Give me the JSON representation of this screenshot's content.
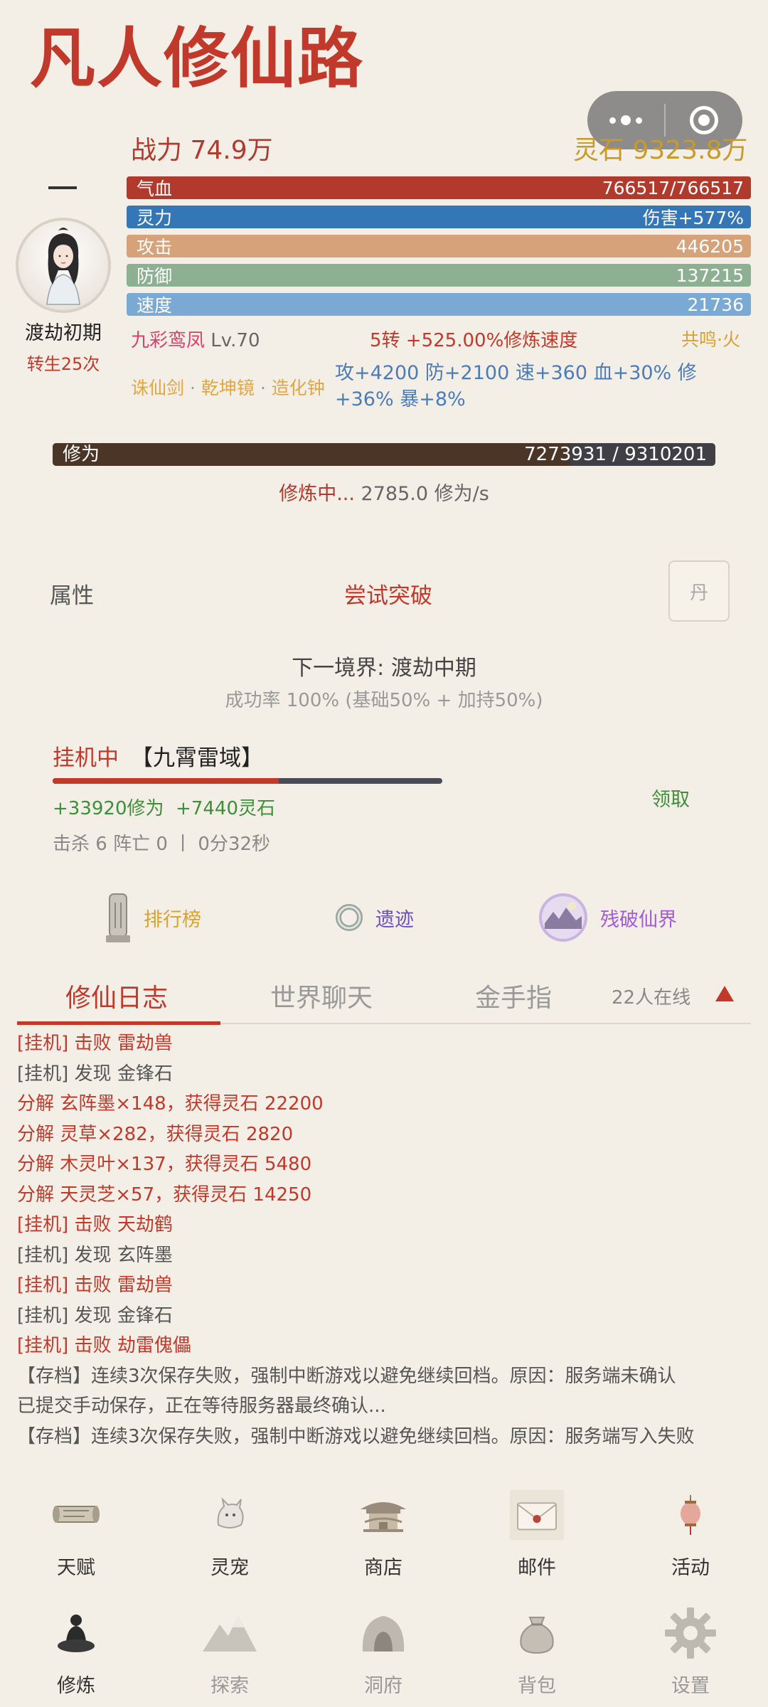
{
  "app": {
    "title": "凡人修仙路"
  },
  "header": {
    "power": "战力 74.9万",
    "stones": "灵石 9323.8万",
    "dash": "—"
  },
  "character": {
    "realm": "渡劫初期",
    "rebirth": "转生25次"
  },
  "stats": {
    "hp": {
      "label": "气血",
      "value": "766517/766517"
    },
    "mp": {
      "label": "灵力",
      "value": "伤害+577%"
    },
    "atk": {
      "label": "攻击",
      "value": "446205"
    },
    "def": {
      "label": "防御",
      "value": "137215"
    },
    "spd": {
      "label": "速度",
      "value": "21736"
    }
  },
  "pet": {
    "name": "九彩鸾凤",
    "level": "Lv.70"
  },
  "rebirth_speed": "5转 +525.00%修炼速度",
  "resonance": "共鸣·火",
  "artifacts": {
    "a1": "诛仙剑",
    "a2": "乾坤镜",
    "a3": "造化钟",
    "sep": " · "
  },
  "bonus": "攻+4200 防+2100 速+360 血+30% 修+36% 暴+8%",
  "cultivation": {
    "label": "修为",
    "value": "7273931 / 9310201",
    "progress": 0.781,
    "status": "修炼中...",
    "rate": "2785.0 修为/s"
  },
  "actions": {
    "attr": "属性",
    "breakthrough": "尝试突破",
    "dan": "丹"
  },
  "next": {
    "realm": "下一境界: 渡劫中期",
    "rate": "成功率 100% (基础50% + 加持50%)"
  },
  "afk": {
    "status": "挂机中",
    "zone": "【九霄雷域】",
    "progress": 0.58,
    "gain_exp": "+33920修为",
    "gain_stone": "+7440灵石",
    "claim": "领取",
    "stats": "击杀 6  阵亡 0 丨 0分32秒"
  },
  "portals": {
    "rank": "排行榜",
    "ruin": "遗迹",
    "broken": "残破仙界"
  },
  "tabs": {
    "log": "修仙日志",
    "chat": "世界聊天",
    "gold": "金手指",
    "online": "22人在线"
  },
  "log": [
    {
      "text": "[挂机] 击败 雷劫兽",
      "c": "r"
    },
    {
      "text": "[挂机] 发现 金锋石",
      "c": "g"
    },
    {
      "text": "分解 玄阵墨×148，获得灵石 22200",
      "c": "r"
    },
    {
      "text": "分解 灵草×282，获得灵石 2820",
      "c": "r"
    },
    {
      "text": "分解 木灵叶×137，获得灵石 5480",
      "c": "r"
    },
    {
      "text": "分解 天灵芝×57，获得灵石 14250",
      "c": "r"
    },
    {
      "text": "[挂机] 击败 天劫鹤",
      "c": "r"
    },
    {
      "text": "[挂机] 发现 玄阵墨",
      "c": "g"
    },
    {
      "text": "[挂机] 击败 雷劫兽",
      "c": "r"
    },
    {
      "text": "[挂机] 发现 金锋石",
      "c": "g"
    },
    {
      "text": "[挂机] 击败 劫雷傀儡",
      "c": "r"
    },
    {
      "text": "【存档】连续3次保存失败，强制中断游戏以避免继续回档。原因：服务端未确认",
      "c": "g"
    },
    {
      "text": "已提交手动保存，正在等待服务器最终确认...",
      "c": "g"
    },
    {
      "text": "【存档】连续3次保存失败，强制中断游戏以避免继续回档。原因：服务端写入失败",
      "c": "g"
    }
  ],
  "nav_row1": [
    "天赋",
    "灵宠",
    "商店",
    "邮件",
    "活动"
  ],
  "nav_row2": [
    "修炼",
    "探索",
    "洞府",
    "背包",
    "设置"
  ]
}
